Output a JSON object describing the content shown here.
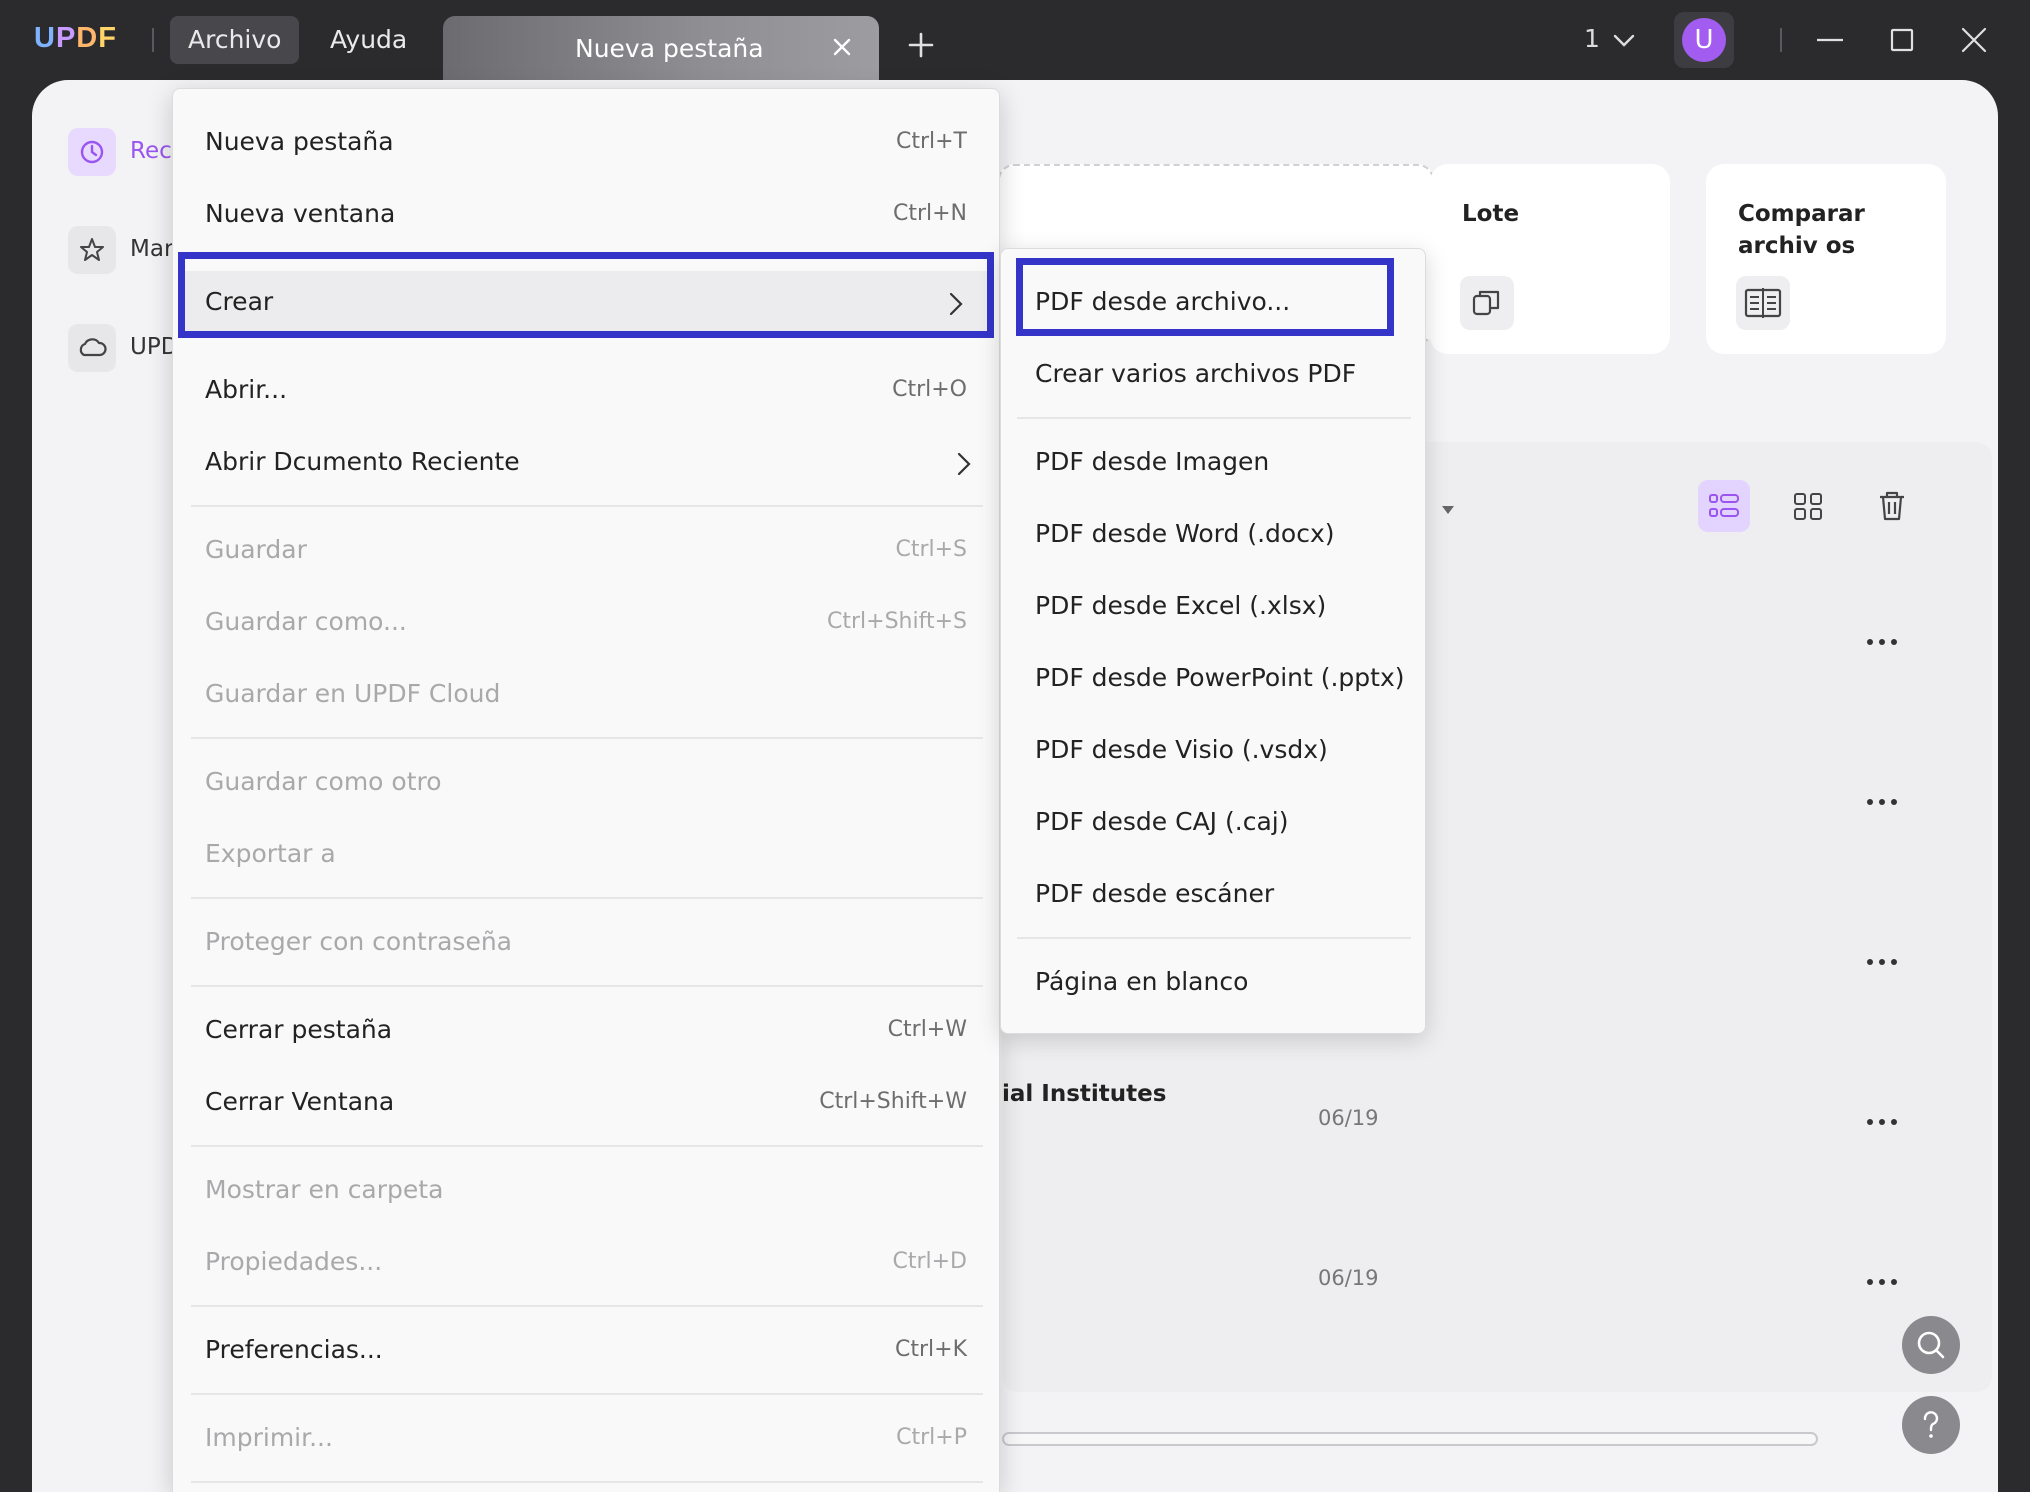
{
  "app": {
    "logo": "UPDF"
  },
  "menubar": {
    "archivo": "Archivo",
    "ayuda": "Ayuda"
  },
  "tab": {
    "title": "Nueva pestaña"
  },
  "page_indicator": "1",
  "user": {
    "avatar_letter": "U"
  },
  "sidebar": {
    "items": [
      {
        "label": "Reci"
      },
      {
        "label": "Mar"
      },
      {
        "label": "UPD"
      }
    ]
  },
  "cards": {
    "batch": "Lote",
    "compare": "Comparar archiv os"
  },
  "files": [
    {
      "name": "ial Institutes",
      "date": "06/19"
    },
    {
      "name": "",
      "date": "06/19"
    }
  ],
  "file_menu": {
    "items": [
      {
        "label": "Nueva pestaña",
        "shortcut": "Ctrl+T"
      },
      {
        "label": "Nueva ventana",
        "shortcut": "Ctrl+N"
      },
      {
        "label": "Crear",
        "shortcut": ""
      },
      {
        "label": "Abrir...",
        "shortcut": "Ctrl+O"
      },
      {
        "label": "Abrir Dcumento Reciente",
        "shortcut": ""
      },
      {
        "label": "Guardar",
        "shortcut": "Ctrl+S"
      },
      {
        "label": "Guardar como...",
        "shortcut": "Ctrl+Shift+S"
      },
      {
        "label": "Guardar en UPDF Cloud",
        "shortcut": ""
      },
      {
        "label": "Guardar como otro",
        "shortcut": ""
      },
      {
        "label": "Exportar a",
        "shortcut": ""
      },
      {
        "label": "Proteger con contraseña",
        "shortcut": ""
      },
      {
        "label": "Cerrar pestaña",
        "shortcut": "Ctrl+W"
      },
      {
        "label": "Cerrar Ventana",
        "shortcut": "Ctrl+Shift+W"
      },
      {
        "label": "Mostrar en carpeta",
        "shortcut": ""
      },
      {
        "label": "Propiedades...",
        "shortcut": "Ctrl+D"
      },
      {
        "label": "Preferencias...",
        "shortcut": "Ctrl+K"
      },
      {
        "label": "Imprimir...",
        "shortcut": "Ctrl+P"
      }
    ]
  },
  "create_submenu": {
    "items": [
      {
        "label": "PDF desde archivo..."
      },
      {
        "label": "Crear varios archivos PDF"
      },
      {
        "label": "PDF desde Imagen"
      },
      {
        "label": "PDF desde Word (.docx)"
      },
      {
        "label": "PDF desde Excel (.xlsx)"
      },
      {
        "label": "PDF desde PowerPoint (.pptx)"
      },
      {
        "label": "PDF desde Visio (.vsdx)"
      },
      {
        "label": "PDF desde CAJ (.caj)"
      },
      {
        "label": "PDF desde escáner"
      },
      {
        "label": "Página en blanco"
      }
    ]
  },
  "colors": {
    "accent": "#9a55f0",
    "highlight_border": "#3434c9",
    "titlebar": "#2b2b2d"
  }
}
